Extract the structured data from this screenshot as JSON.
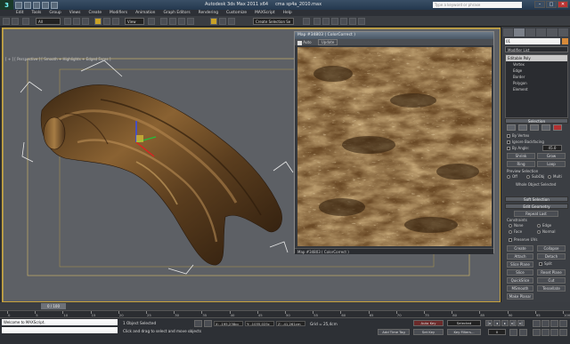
{
  "title": {
    "app": "Autodesk 3ds Max  2011 x64",
    "file": "cma sp4a_2010.max"
  },
  "search": {
    "placeholder": "Type a keyword or phrase"
  },
  "menu": [
    "Edit",
    "Tools",
    "Group",
    "Views",
    "Create",
    "Modifiers",
    "Animation",
    "Graph Editors",
    "Rendering",
    "Customize",
    "MAXScript",
    "Help"
  ],
  "toolbar": {
    "filter": "All",
    "view": "View",
    "selection_set": "Create Selection Se"
  },
  "viewport": {
    "label": "[ + ] [ Perspective ] [ Smooth + Highlights + Edged Faces ]"
  },
  "material_window": {
    "title": "Map #34803 ( ColorCorrect )",
    "auto_label": "Auto",
    "update_label": "Update",
    "status": "Map #34803 ( ColorCorrect )"
  },
  "command_panel": {
    "object_name": "01",
    "modifier_list": "Modifier List",
    "stack": [
      {
        "label": "Editable Poly",
        "kind": "top"
      },
      {
        "label": "Vertex",
        "kind": "sub"
      },
      {
        "label": "Edge",
        "kind": "sub"
      },
      {
        "label": "Border",
        "kind": "sub"
      },
      {
        "label": "Polygon",
        "kind": "sub"
      },
      {
        "label": "Element",
        "kind": "sub"
      }
    ],
    "selection_head": "Selection",
    "by_vertex": "By Vertex",
    "ignore_backfacing": "Ignore Backfacing",
    "by_angle": "By Angle:",
    "by_angle_value": "45.0",
    "shrink": "Shrink",
    "grow": "Grow",
    "ring": "Ring",
    "loop": "Loop",
    "preview_selection": "Preview Selection",
    "preview_off": "Off",
    "preview_subobj": "SubObj",
    "preview_multi": "Multi",
    "whole_object": "Whole Object Selected",
    "soft_selection": "Soft Selection",
    "edit_geometry": "Edit Geometry",
    "repeat_last": "Repeat Last",
    "constraints": "Constraints",
    "none": "None",
    "edge": "Edge",
    "face": "Face",
    "normal": "Normal",
    "preserve_uvs": "Preserve UVs",
    "create": "Create",
    "collapse": "Collapse",
    "attach": "Attach",
    "detach": "Detach",
    "slice_plane": "Slice Plane",
    "split": "Split",
    "slice": "Slice",
    "reset_plane": "Reset Plane",
    "quickslice": "QuickSlice",
    "cut": "Cut",
    "msmooth": "MSmooth",
    "tessellate": "Tessellate",
    "make_planar": "Make Planar",
    "view_align": "View Align",
    "grid_align": "Grid Align",
    "relax": "Relax"
  },
  "timeline": {
    "frame": "0 / 100"
  },
  "ruler_ticks": [
    "0",
    "5",
    "10",
    "15",
    "20",
    "25",
    "30",
    "35",
    "40",
    "45",
    "50",
    "55",
    "60",
    "65",
    "70",
    "75",
    "80",
    "85",
    "90",
    "95",
    "100"
  ],
  "status": {
    "maxscript": "Welcome to MAXScript.",
    "objects_selected": "1 Object Selected",
    "prompt": "Click and drag to select and move objects",
    "x": "X: -195,238cc",
    "y": "Y: -1035,025c",
    "z": "Z: -41,261cm",
    "grid": "Grid = 25,4cm",
    "auto_key": "Auto Key",
    "set_key": "Set Key",
    "selected": "Selected",
    "key_filters": "Key Filters...",
    "add_time_tag": "Add Time Tag",
    "frame_value": "0"
  }
}
